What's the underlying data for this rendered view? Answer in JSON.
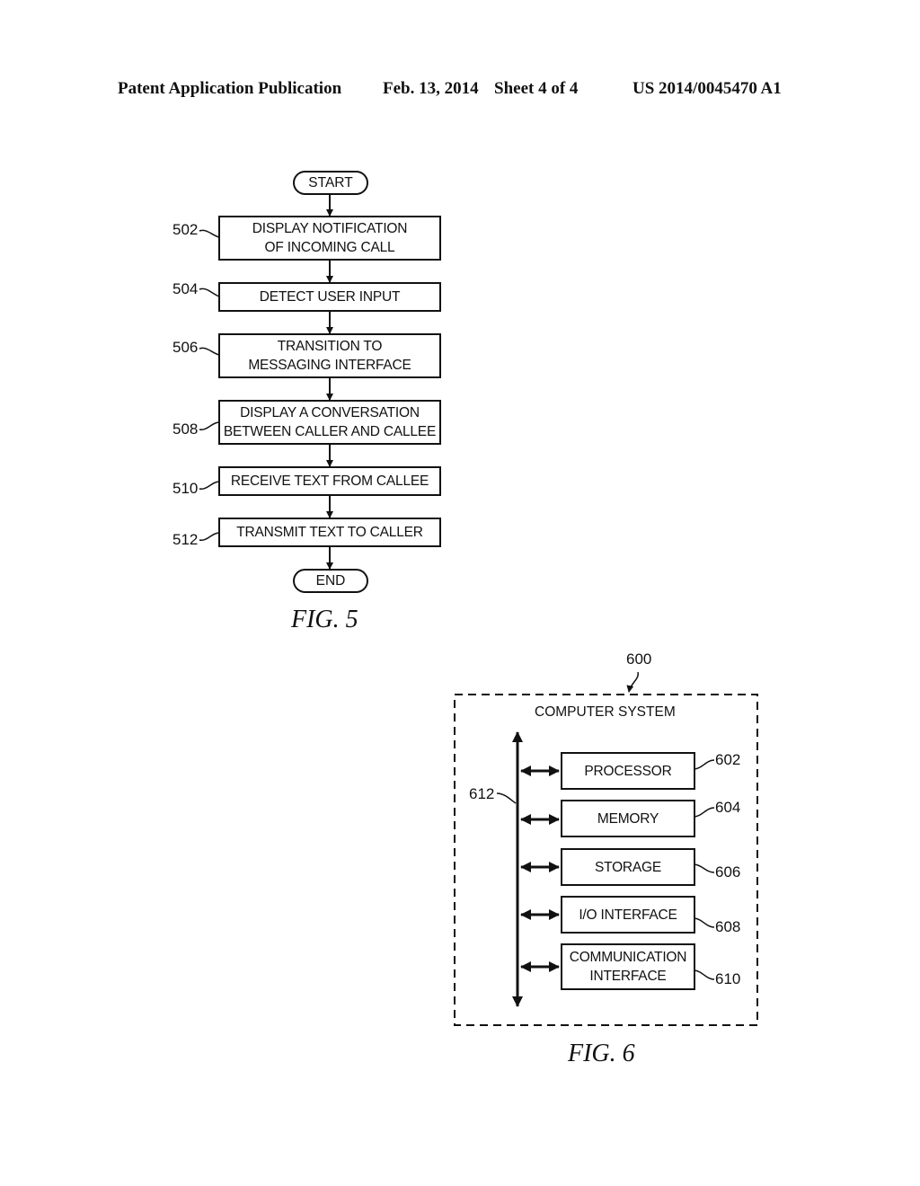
{
  "header": {
    "publication_type": "Patent Application Publication",
    "date": "Feb. 13, 2014",
    "sheet": "Sheet 4 of 4",
    "publication_number": "US 2014/0045470 A1"
  },
  "fig5": {
    "caption": "FIG. 5",
    "start_label": "START",
    "end_label": "END",
    "steps": [
      {
        "ref": "502",
        "line1": "DISPLAY NOTIFICATION",
        "line2": "OF INCOMING CALL"
      },
      {
        "ref": "504",
        "line1": "DETECT USER INPUT",
        "line2": ""
      },
      {
        "ref": "506",
        "line1": "TRANSITION TO",
        "line2": "MESSAGING INTERFACE"
      },
      {
        "ref": "508",
        "line1": "DISPLAY A CONVERSATION",
        "line2": "BETWEEN CALLER AND CALLEE"
      },
      {
        "ref": "510",
        "line1": "RECEIVE TEXT FROM CALLEE",
        "line2": ""
      },
      {
        "ref": "512",
        "line1": "TRANSMIT TEXT TO CALLER",
        "line2": ""
      }
    ]
  },
  "fig6": {
    "caption": "FIG. 6",
    "system_ref": "600",
    "system_title": "COMPUTER SYSTEM",
    "bus_ref": "612",
    "components": [
      {
        "ref": "602",
        "line1": "PROCESSOR",
        "line2": ""
      },
      {
        "ref": "604",
        "line1": "MEMORY",
        "line2": ""
      },
      {
        "ref": "606",
        "line1": "STORAGE",
        "line2": ""
      },
      {
        "ref": "608",
        "line1": "I/O INTERFACE",
        "line2": ""
      },
      {
        "ref": "610",
        "line1": "COMMUNICATION",
        "line2": "INTERFACE"
      }
    ]
  }
}
